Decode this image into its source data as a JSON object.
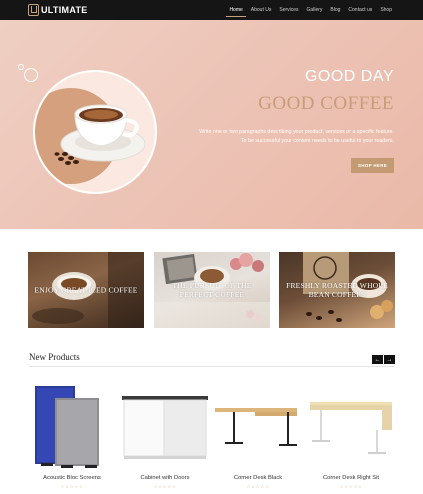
{
  "brand": {
    "logo_letter": "U",
    "name": "ULTIMATE"
  },
  "nav": {
    "items": [
      {
        "label": "Home",
        "active": true
      },
      {
        "label": "About Us",
        "active": false
      },
      {
        "label": "Services",
        "active": false
      },
      {
        "label": "Gallery",
        "active": false
      },
      {
        "label": "Blog",
        "active": false
      },
      {
        "label": "Contact us",
        "active": false
      },
      {
        "label": "Shop",
        "active": false
      }
    ]
  },
  "hero": {
    "title_1": "GOOD DAY",
    "title_2": "GOOD COFFEE",
    "desc_line_1": "Write one or two paragraphs describing your product, services or a specific feature.",
    "desc_line_2": "To be successful your content needs to be useful to your readers.",
    "button_label": "SHOP HERE",
    "colors": {
      "accent": "#c49a73",
      "title_2": "#c79d77"
    }
  },
  "promos": [
    {
      "line_1": "ENJOY GREAT ICED COFFEE",
      "line_2": ""
    },
    {
      "line_1": "THE PURSUIT OF THE",
      "line_2": "PERFECT COFFEE"
    },
    {
      "line_1": "FRESHLY ROASTED WHOLE",
      "line_2": "BEAN COFFEES"
    }
  ],
  "products_section": {
    "title": "New Products",
    "prev_icon": "arrow-left-icon",
    "next_icon": "arrow-right-icon",
    "prev_glyph": "←",
    "next_glyph": "→",
    "items": [
      {
        "name": "Acoustic Bloc Screens",
        "rating": "☆☆☆☆☆"
      },
      {
        "name": "Cabinet with Doors",
        "rating": "☆☆☆☆☆"
      },
      {
        "name": "Corner Desk Black",
        "rating": "☆☆☆☆☆"
      },
      {
        "name": "Corner Desk Right Sit",
        "rating": "☆☆☆☆☆"
      }
    ]
  }
}
